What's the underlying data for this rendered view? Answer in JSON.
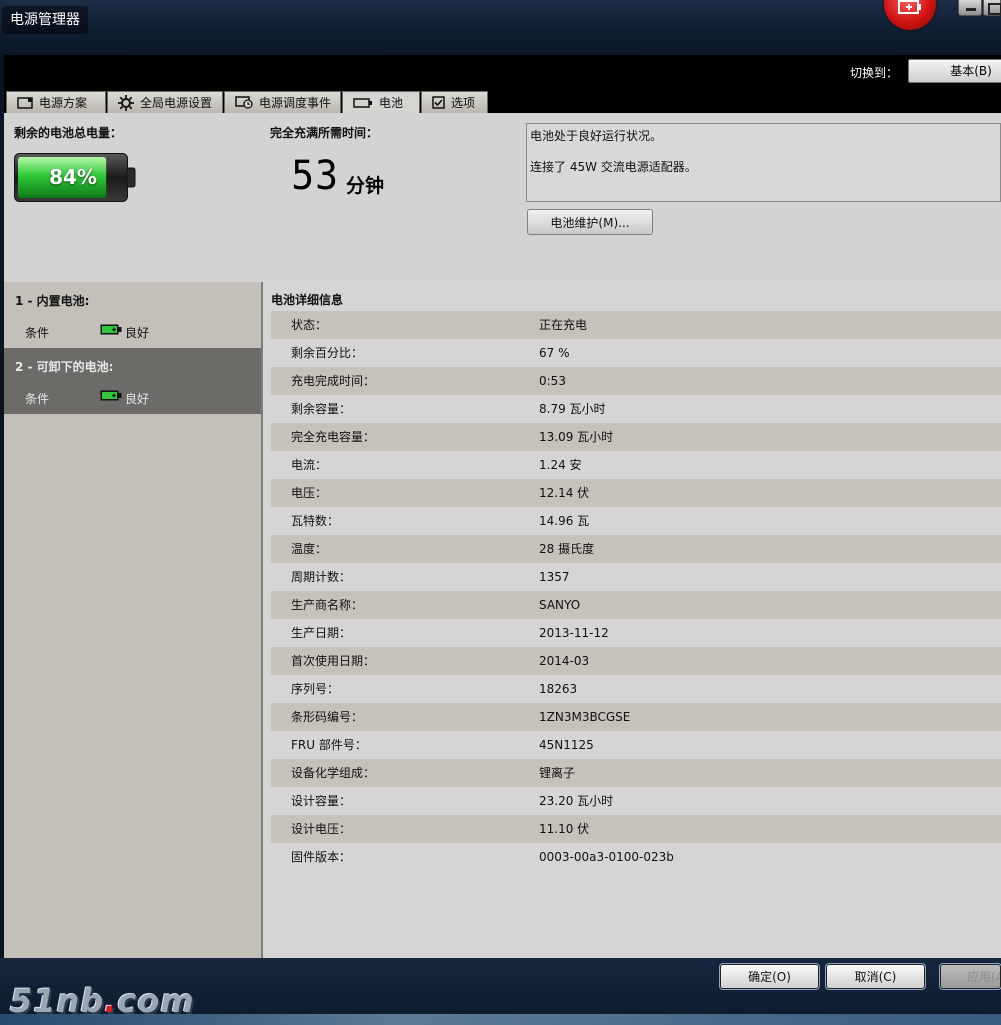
{
  "window": {
    "title": "电源管理器"
  },
  "toolbar": {
    "switch_label": "切换到：",
    "switch_button": "基本(B)"
  },
  "tabs": [
    {
      "label": "电源方案",
      "icon": "monitor-icon"
    },
    {
      "label": "全局电源设置",
      "icon": "gear-icon"
    },
    {
      "label": "电源调度事件",
      "icon": "scheduled-event-icon"
    },
    {
      "label": "电池",
      "icon": "battery-icon",
      "active": true
    },
    {
      "label": "选项",
      "icon": "checkbox-icon"
    }
  ],
  "summary": {
    "remaining_label": "剩余的电池总电量：",
    "remaining_percent": "84%",
    "remaining_fraction": 0.84,
    "full_charge_label": "完全充满所需时间：",
    "minutes": "53",
    "minutes_unit": "分钟",
    "status_line1": "电池处于良好运行状况。",
    "status_line2": "连接了 45W 交流电源适配器。",
    "maintenance_button": "电池维护(M)..."
  },
  "batteries": [
    {
      "name": "1 - 内置电池:",
      "condition_label": "条件",
      "condition_value": "良好",
      "selected": false
    },
    {
      "name": "2 - 可卸下的电池:",
      "condition_label": "条件",
      "condition_value": "良好",
      "selected": true
    }
  ],
  "details": {
    "title": "电池详细信息",
    "rows": [
      {
        "key": "状态：",
        "value": "正在充电"
      },
      {
        "key": "剩余百分比：",
        "value": "67 %"
      },
      {
        "key": "充电完成时间：",
        "value": "0:53"
      },
      {
        "key": "剩余容量：",
        "value": "8.79 瓦小时"
      },
      {
        "key": "完全充电容量：",
        "value": "13.09 瓦小时"
      },
      {
        "key": "电流：",
        "value": "1.24 安"
      },
      {
        "key": "电压：",
        "value": "12.14 伏"
      },
      {
        "key": "瓦特数：",
        "value": "14.96 瓦"
      },
      {
        "key": "温度：",
        "value": "28 摄氏度"
      },
      {
        "key": "周期计数：",
        "value": "1357"
      },
      {
        "key": "生产商名称：",
        "value": "SANYO"
      },
      {
        "key": "生产日期：",
        "value": "2013-11-12"
      },
      {
        "key": "首次使用日期：",
        "value": "2014-03"
      },
      {
        "key": "序列号：",
        "value": "18263"
      },
      {
        "key": "条形码编号：",
        "value": "1ZN3M3BCGSE"
      },
      {
        "key": "FRU 部件号：",
        "value": "45N1125"
      },
      {
        "key": "设备化学组成：",
        "value": "锂离子"
      },
      {
        "key": "设计容量：",
        "value": "23.20 瓦小时"
      },
      {
        "key": "设计电压：",
        "value": "11.10 伏"
      },
      {
        "key": "固件版本：",
        "value": "0003-00a3-0100-023b"
      }
    ]
  },
  "dialog": {
    "ok": "确定(O)",
    "cancel": "取消(C)",
    "apply": "应用(A)"
  },
  "watermark": {
    "text_a": "51nb",
    "dot": ".",
    "text_b": "com"
  },
  "colors": {
    "battery_green": "#2fc93a",
    "selected_row": "#6d6b68",
    "accent_red": "#d11313"
  }
}
